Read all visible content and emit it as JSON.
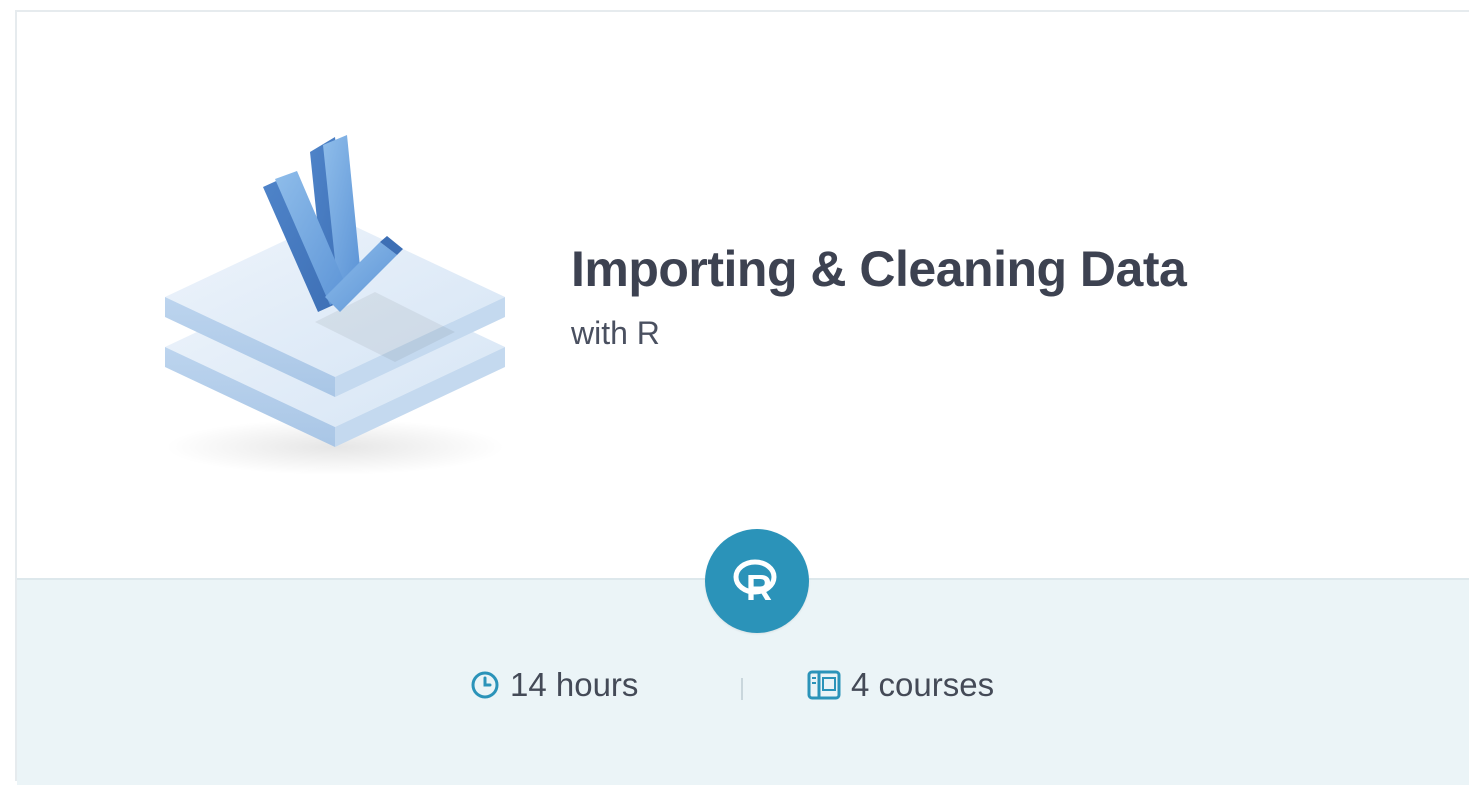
{
  "track": {
    "title": "Importing & Cleaning Data",
    "subtitle": "with R"
  },
  "badge": {
    "technology_letter": "R",
    "color": "#2b93b9"
  },
  "meta": {
    "duration": "14 hours",
    "courses": "4 courses"
  },
  "icons": {
    "illustration": "download-arrow-layers-icon",
    "duration": "clock-icon",
    "courses": "courses-icon"
  },
  "colors": {
    "accent": "#2b93b9",
    "footer_bg": "#ebf4f7",
    "title": "#3d4251"
  }
}
